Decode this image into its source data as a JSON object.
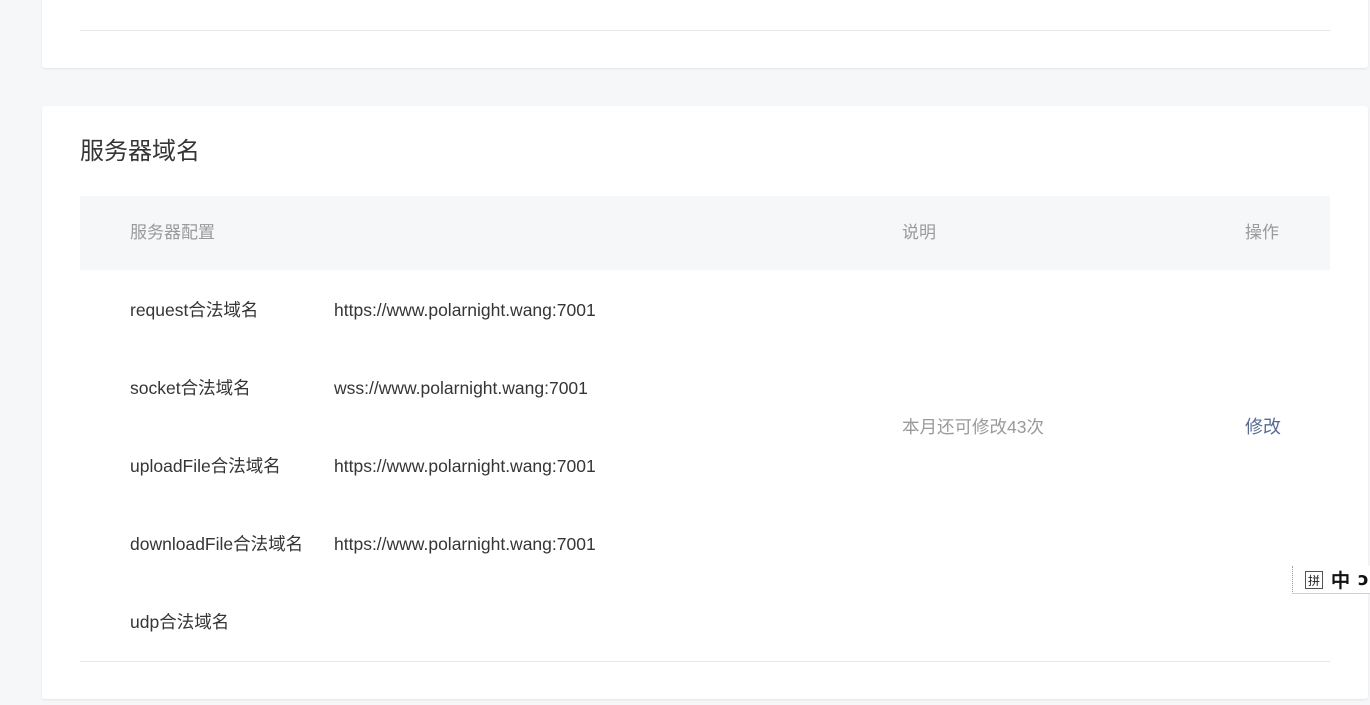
{
  "server_domains": {
    "title": "服务器域名",
    "headers": {
      "config": "服务器配置",
      "description": "说明",
      "operation": "操作"
    },
    "rows": [
      {
        "label": "request合法域名",
        "value": "https://www.polarnight.wang:7001"
      },
      {
        "label": "socket合法域名",
        "value": "wss://www.polarnight.wang:7001"
      },
      {
        "label": "uploadFile合法域名",
        "value": "https://www.polarnight.wang:7001"
      },
      {
        "label": "downloadFile合法域名",
        "value": "https://www.polarnight.wang:7001"
      },
      {
        "label": "udp合法域名",
        "value": ""
      }
    ],
    "description": "本月还可修改43次",
    "modify_label": "修改"
  },
  "ime": {
    "mode_glyph": "拼",
    "lang": "中",
    "punct_glyph": "ↄ"
  },
  "colors": {
    "link": "#576b95",
    "muted": "#9a9a9a",
    "text": "#353535",
    "header_bg": "#f6f7f9"
  }
}
